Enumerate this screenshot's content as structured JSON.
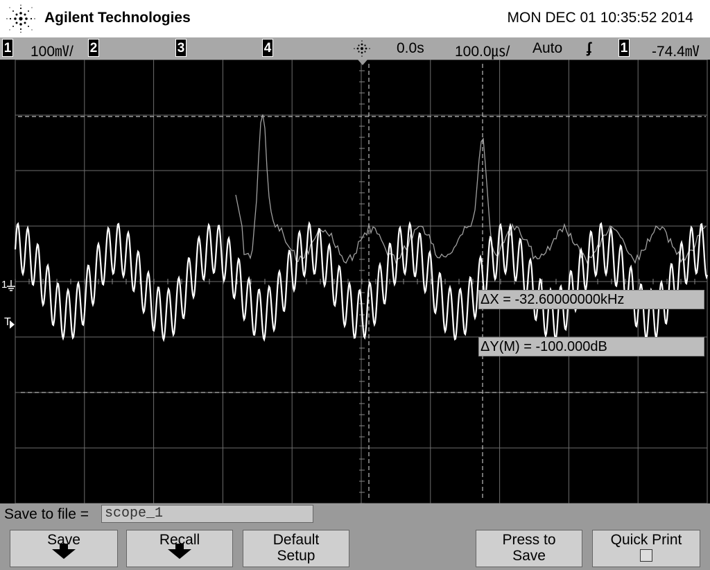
{
  "header": {
    "brand": "Agilent Technologies",
    "datetime": "MON DEC 01 10:35:52 2014"
  },
  "status": {
    "ch1_label": "1",
    "ch1_scale": "100㎷/",
    "ch2_label": "2",
    "ch3_label": "3",
    "ch4_label": "4",
    "time_delay": "0.0s",
    "time_scale": "100.0㎲/",
    "trigger_mode": "Auto",
    "trigger_slope": "ʄ",
    "trigger_source": "1",
    "trigger_level": "-74.4㎷"
  },
  "markers": {
    "ch1_ground": "1",
    "trigger": "T"
  },
  "readouts": {
    "delta_x": "ΔX = -32.60000000kHz",
    "delta_y": "ΔY(M) = -100.000dB"
  },
  "softkeys": {
    "save_to_file_label": "Save to file =",
    "file_name": "scope_1",
    "save": "Save",
    "recall": "Recall",
    "default_line1": "Default",
    "default_line2": "Setup",
    "press_line1": "Press to",
    "press_line2": "Save",
    "quick_print": "Quick Print"
  },
  "colors": {
    "background": "#000000",
    "grid": "#7a7a7a",
    "trace_time": "#ffffff",
    "trace_fft": "#9a9a9a",
    "statusbar": "#a8a8a8",
    "softkey": "#cfcfcf"
  }
}
